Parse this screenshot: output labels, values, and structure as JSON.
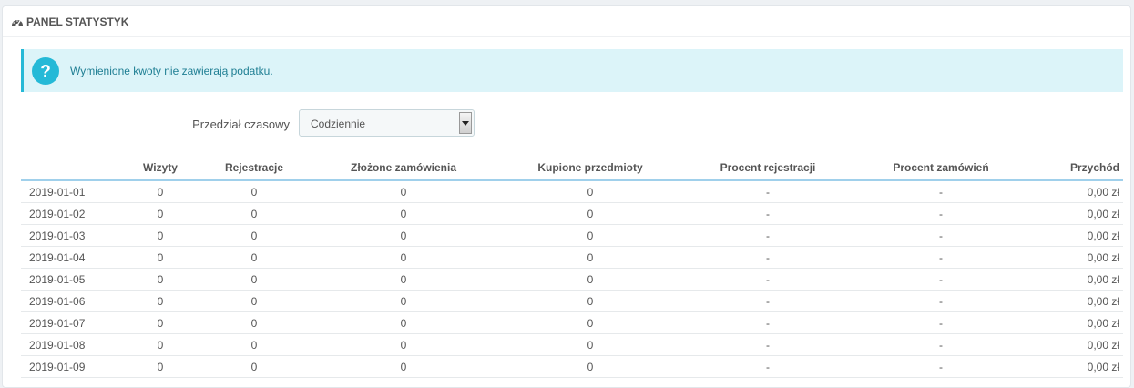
{
  "panel": {
    "title": "PANEL STATYSTYK",
    "icon": "dashboard-icon"
  },
  "alert": {
    "icon": "question-icon",
    "message": "Wymienione kwoty nie zawierają podatku."
  },
  "filter": {
    "label": "Przedział czasowy",
    "selected": "Codziennie"
  },
  "table": {
    "headers": [
      "",
      "Wizyty",
      "Rejestracje",
      "Złożone zamówienia",
      "Kupione przedmioty",
      "Procent rejestracji",
      "Procent zamówień",
      "Przychód"
    ],
    "rows": [
      [
        "2019-01-01",
        "0",
        "0",
        "0",
        "0",
        "-",
        "-",
        "0,00 zł"
      ],
      [
        "2019-01-02",
        "0",
        "0",
        "0",
        "0",
        "-",
        "-",
        "0,00 zł"
      ],
      [
        "2019-01-03",
        "0",
        "0",
        "0",
        "0",
        "-",
        "-",
        "0,00 zł"
      ],
      [
        "2019-01-04",
        "0",
        "0",
        "0",
        "0",
        "-",
        "-",
        "0,00 zł"
      ],
      [
        "2019-01-05",
        "0",
        "0",
        "0",
        "0",
        "-",
        "-",
        "0,00 zł"
      ],
      [
        "2019-01-06",
        "0",
        "0",
        "0",
        "0",
        "-",
        "-",
        "0,00 zł"
      ],
      [
        "2019-01-07",
        "0",
        "0",
        "0",
        "0",
        "-",
        "-",
        "0,00 zł"
      ],
      [
        "2019-01-08",
        "0",
        "0",
        "0",
        "0",
        "-",
        "-",
        "0,00 zł"
      ],
      [
        "2019-01-09",
        "0",
        "0",
        "0",
        "0",
        "-",
        "-",
        "0,00 zł"
      ]
    ]
  },
  "colors": {
    "alert_bg": "#dcf4f9",
    "alert_accent": "#25b9d7",
    "alert_text": "#1e7e93",
    "header_border": "#a0d0eb"
  }
}
